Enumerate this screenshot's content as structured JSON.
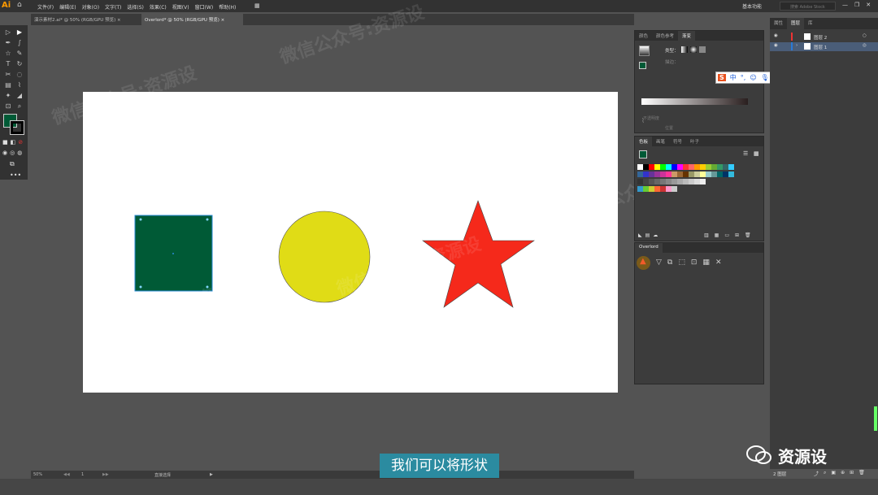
{
  "app": {
    "logo": "Ai",
    "workspace": "基本功能",
    "search_placeholder": "搜索 Adobe Stock"
  },
  "menu": [
    "文件(F)",
    "编辑(E)",
    "对象(O)",
    "文字(T)",
    "选择(S)",
    "效果(C)",
    "视图(V)",
    "窗口(W)",
    "帮助(H)"
  ],
  "tabs": [
    {
      "label": "演示素材2.ai* @ 50% (RGB/GPU 预览)"
    },
    {
      "label": "Overlord* @ 50% (RGB/GPU 预览)"
    }
  ],
  "gradient_panel": {
    "tabs": [
      "颜色",
      "颜色参考",
      "渐变"
    ],
    "type_label": "类型：",
    "stroke_label": "描边：",
    "opacity_label": "不透明度",
    "position_label": "位置"
  },
  "swatches_panel": {
    "tabs": [
      "色板",
      "画笔",
      "符号",
      "叶子"
    ]
  },
  "overlord_panel": {
    "title": "Overlord"
  },
  "layers_panel": {
    "tabs": [
      "属性",
      "图层",
      "库"
    ],
    "layers": [
      {
        "name": "图层 2"
      },
      {
        "name": "图层 1"
      }
    ],
    "count_label": "2 图层"
  },
  "status": {
    "zoom": "50%",
    "page": "1",
    "tool_name": "直接选择"
  },
  "subtitle": "我们可以将形状",
  "watermark": {
    "brand": "资源设",
    "text": "微信公众号:资源设"
  },
  "colors": {
    "square": "#005a36",
    "circle": "#e0dc16",
    "star": "#f5291b",
    "accent": "#2b8ba0"
  }
}
